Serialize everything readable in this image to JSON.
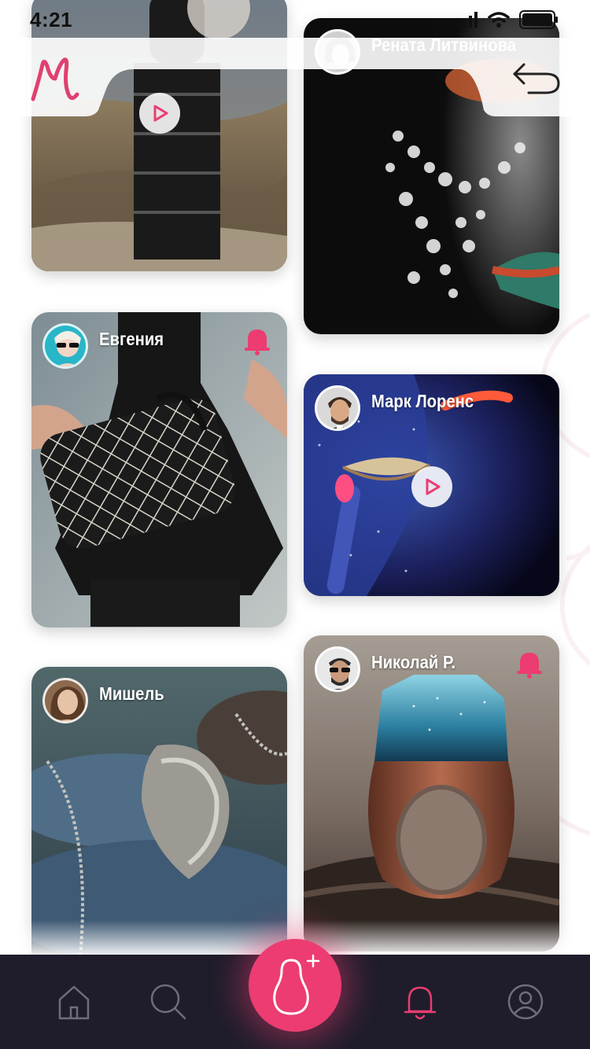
{
  "status_bar": {
    "time": "4:21"
  },
  "header": {
    "logo_icon": "brand-m-logo",
    "back_icon": "back-arrow-icon"
  },
  "colors": {
    "accent": "#ec3c72",
    "nav_bg": "#1f1d2b",
    "nav_icon": "#6f6e78"
  },
  "feed": {
    "posts": [
      {
        "id": "post-1",
        "author": "",
        "has_video": true,
        "has_notification": false
      },
      {
        "id": "post-2",
        "author": "Рената Литвинова",
        "has_video": false,
        "has_notification": false
      },
      {
        "id": "post-3",
        "author": "Евгения",
        "has_video": false,
        "has_notification": true
      },
      {
        "id": "post-4",
        "author": "Марк Лоренс",
        "has_video": true,
        "has_notification": false
      },
      {
        "id": "post-5",
        "author": "Мишель",
        "has_video": false,
        "has_notification": false
      },
      {
        "id": "post-6",
        "author": "Николай Р.",
        "has_video": false,
        "has_notification": true
      }
    ]
  },
  "bottom_nav": {
    "items": [
      {
        "name": "home",
        "icon": "home-icon",
        "active": false
      },
      {
        "name": "search",
        "icon": "search-icon",
        "active": false
      },
      {
        "name": "create",
        "icon": "matryoshka-plus-icon",
        "active": false
      },
      {
        "name": "notifications",
        "icon": "bell-icon",
        "active": true
      },
      {
        "name": "profile",
        "icon": "profile-icon",
        "active": false
      }
    ]
  }
}
